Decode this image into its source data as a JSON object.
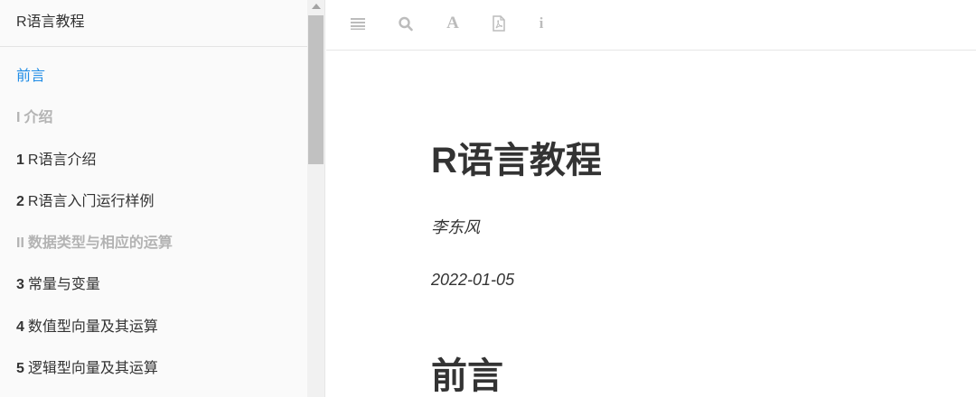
{
  "sidebar": {
    "book_title": "R语言教程",
    "items": [
      {
        "num": "",
        "label": "前言",
        "kind": "active"
      },
      {
        "num": "I",
        "label": "介绍",
        "kind": "part"
      },
      {
        "num": "1",
        "label": "R语言介绍",
        "kind": "chapter"
      },
      {
        "num": "2",
        "label": "R语言入门运行样例",
        "kind": "chapter"
      },
      {
        "num": "II",
        "label": "数据类型与相应的运算",
        "kind": "part"
      },
      {
        "num": "3",
        "label": "常量与变量",
        "kind": "chapter"
      },
      {
        "num": "4",
        "label": "数值型向量及其运算",
        "kind": "chapter"
      },
      {
        "num": "5",
        "label": "逻辑型向量及其运算",
        "kind": "chapter"
      }
    ]
  },
  "toolbar": {
    "icons": [
      "menu-icon",
      "search-icon",
      "font-settings-icon",
      "pdf-icon",
      "info-icon"
    ],
    "font_glyph": "A",
    "info_glyph": "i"
  },
  "main": {
    "title": "R语言教程",
    "author": "李东风",
    "date": "2022-01-05",
    "section_heading": "前言"
  },
  "colors": {
    "active_link": "#1f8ce6",
    "part_text": "#b3b3b3",
    "icon_gray": "#bcbcbc"
  }
}
